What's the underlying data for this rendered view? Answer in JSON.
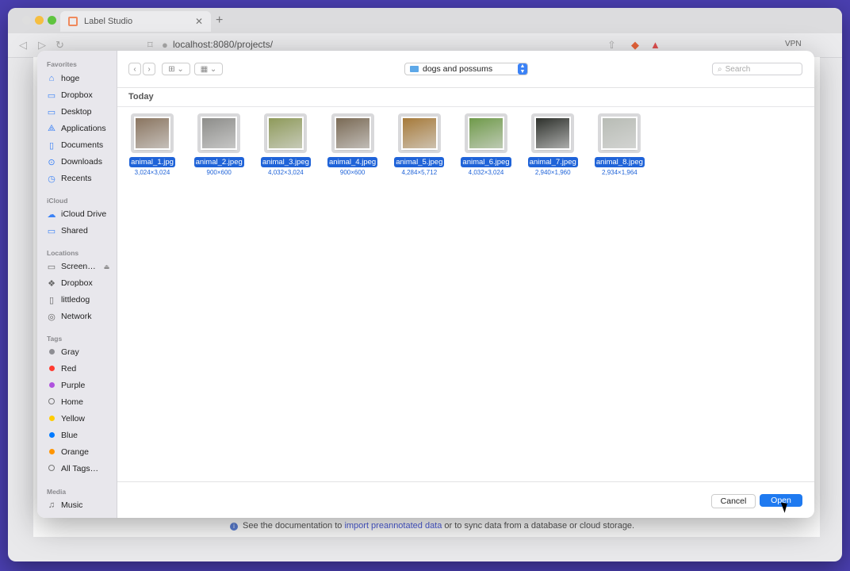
{
  "browser": {
    "tab_title": "Label Studio",
    "tab_close": "✕",
    "new_tab": "+",
    "url": "localhost:8080/projects/",
    "vpn": "VPN"
  },
  "page": {
    "footer_text_1": "See the documentation to ",
    "footer_link": "import preannotated data",
    "footer_text_2": " or to sync data from a database or cloud storage."
  },
  "sidebar": {
    "favorites_header": "Favorites",
    "favorites": [
      {
        "label": "hoge",
        "icon": "house-icon"
      },
      {
        "label": "Dropbox",
        "icon": "folder-icon"
      },
      {
        "label": "Desktop",
        "icon": "desktop-icon"
      },
      {
        "label": "Applications",
        "icon": "applications-icon"
      },
      {
        "label": "Documents",
        "icon": "document-icon"
      },
      {
        "label": "Downloads",
        "icon": "download-icon"
      },
      {
        "label": "Recents",
        "icon": "clock-icon"
      }
    ],
    "icloud_header": "iCloud",
    "icloud": [
      {
        "label": "iCloud Drive",
        "icon": "cloud-icon"
      },
      {
        "label": "Shared",
        "icon": "shared-folder-icon"
      }
    ],
    "locations_header": "Locations",
    "locations": [
      {
        "label": "Screen…",
        "icon": "drive-icon"
      },
      {
        "label": "Dropbox",
        "icon": "dropbox-icon"
      },
      {
        "label": "littledog",
        "icon": "file-icon"
      },
      {
        "label": "Network",
        "icon": "globe-icon"
      }
    ],
    "tags_header": "Tags",
    "tags": [
      {
        "label": "Gray",
        "color": "#8e8e93"
      },
      {
        "label": "Red",
        "color": "#ff3b30"
      },
      {
        "label": "Purple",
        "color": "#af52de"
      },
      {
        "label": "Home",
        "color": ""
      },
      {
        "label": "Yellow",
        "color": "#ffcc00"
      },
      {
        "label": "Blue",
        "color": "#007aff"
      },
      {
        "label": "Orange",
        "color": "#ff9500"
      },
      {
        "label": "All Tags…",
        "color": ""
      }
    ],
    "media_header": "Media",
    "media": [
      {
        "label": "Music",
        "icon": "music-icon"
      }
    ]
  },
  "toolbar": {
    "location": "dogs and possums",
    "search_placeholder": "Search"
  },
  "files": {
    "group_title": "Today",
    "items": [
      {
        "name": "animal_1.jpg",
        "dims": "3,024×3,024",
        "tone": "#8a7560"
      },
      {
        "name": "animal_2.jpeg",
        "dims": "900×600",
        "tone": "#8d8d8a"
      },
      {
        "name": "animal_3.jpeg",
        "dims": "4,032×3,024",
        "tone": "#8e9a5a"
      },
      {
        "name": "animal_4.jpeg",
        "dims": "900×600",
        "tone": "#7a6a55"
      },
      {
        "name": "animal_5.jpeg",
        "dims": "4,284×5,712",
        "tone": "#a67a3a"
      },
      {
        "name": "animal_6.jpeg",
        "dims": "4,032×3,024",
        "tone": "#6f9a4a"
      },
      {
        "name": "animal_7.jpeg",
        "dims": "2,940×1,960",
        "tone": "#2e312c"
      },
      {
        "name": "animal_8.jpeg",
        "dims": "2,934×1,964",
        "tone": "#b8bcb5"
      }
    ]
  },
  "buttons": {
    "cancel": "Cancel",
    "open": "Open"
  }
}
